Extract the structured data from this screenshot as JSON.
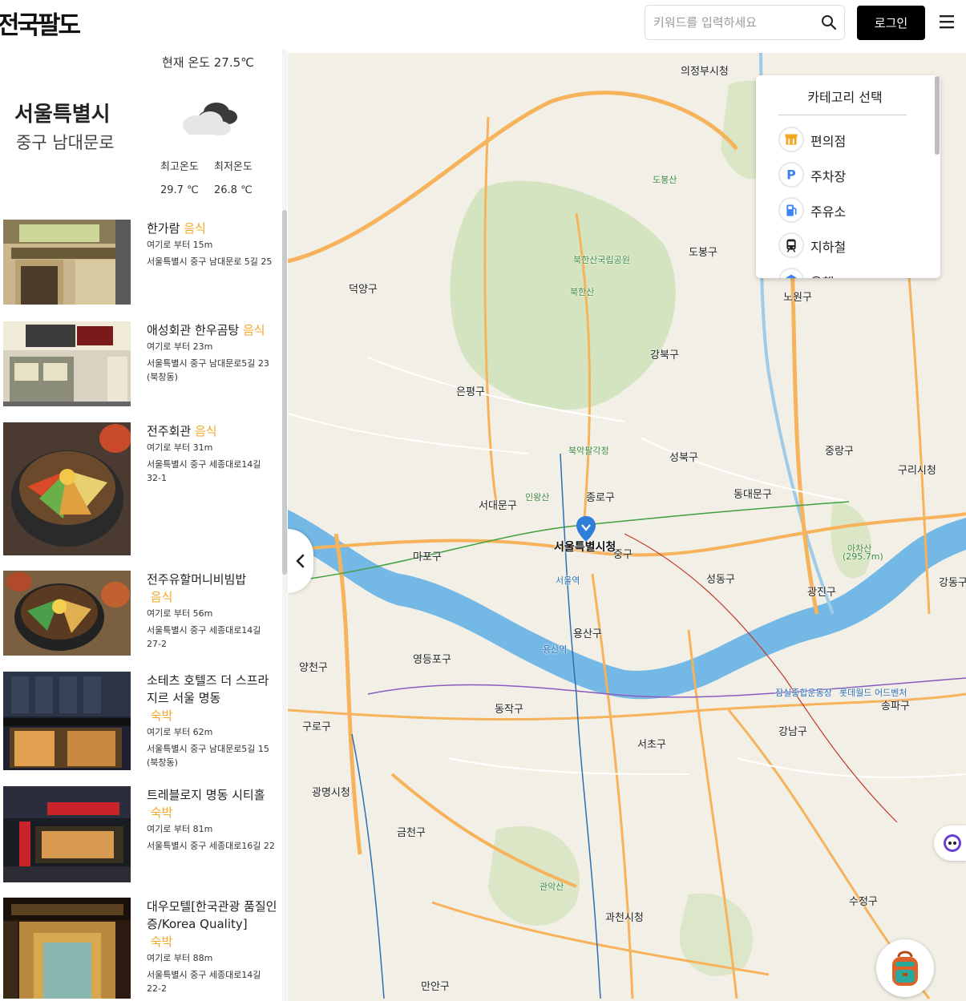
{
  "header": {
    "logo": "전국팔도",
    "search_placeholder": "키워드를 입력하세요",
    "login_label": "로그인"
  },
  "weather": {
    "current_temp": "현재 온도 27.5℃",
    "city": "서울특별시",
    "district": "중구 남대문로",
    "high_label": "최고온도",
    "low_label": "최저온도",
    "high_value": "29.7 ℃",
    "low_value": "26.8 ℃",
    "icon": "cloudy-icon"
  },
  "places": [
    {
      "name": "한가람",
      "category": "음식",
      "distance": "여기로 부터 15m",
      "address": "서울특별시 중구 남대문로 5길 25"
    },
    {
      "name": "애성회관 한우곰탕",
      "category": "음식",
      "distance": "여기로 부터 23m",
      "address": "서울특별시 중구 남대문로5길 23 (북창동)"
    },
    {
      "name": "전주회관",
      "category": "음식",
      "distance": "여기로 부터 31m",
      "address": "서울특별시 중구 세종대로14길 32-1"
    },
    {
      "name": "전주유할머니비빔밥",
      "category": "음식",
      "distance": "여기로 부터 56m",
      "address": "서울특별시 중구 세종대로14길 27-2"
    },
    {
      "name": "소테츠 호텔즈 더 스프라지르 서울 명동",
      "category": "숙박",
      "distance": "여기로 부터 62m",
      "address": "서울특별시 중구 남대문로5길 15 (북창동)"
    },
    {
      "name": "트레블로지 명동 시티홀",
      "category": "숙박",
      "distance": "여기로 부터 81m",
      "address": "서울특별시 중구 세종대로16길 22"
    },
    {
      "name": "대우모텔[한국관광 품질인증/Korea Quality]",
      "category": "숙박",
      "distance": "여기로 부터 88m",
      "address": "서울특별시 중구 세종대로14길 22-2"
    }
  ],
  "map": {
    "center_label": "서울특별시청",
    "labels": {
      "uijeongbu": "의정부시청",
      "dobongsan": "도봉산",
      "bukhansan": "북한산",
      "bukhansan_park": "북한산국립공원",
      "dobong": "도봉구",
      "nowon": "노원구",
      "gangbuk": "강북구",
      "deokyang": "덕양구",
      "eunpyeong": "은평구",
      "seongbuk": "성북구",
      "jungnang": "중랑구",
      "guri": "구리시청",
      "seodaemun": "서대문구",
      "jongno": "종로구",
      "dongdaemun": "동대문구",
      "mapo": "마포구",
      "jung": "중구",
      "seongdong": "성동구",
      "gwangjin": "광진구",
      "yongsan": "용산구",
      "yangcheon": "양천구",
      "yeongdeungpo": "영등포구",
      "dongjak": "동작구",
      "gangnam": "강남구",
      "songpa": "송파구",
      "guro": "구로구",
      "seocho": "서초구",
      "gwangmyeong": "광명시청",
      "geumcheon": "금천구",
      "gwanak": "관악산",
      "gwacheon": "과천시청",
      "sujeong": "수정구",
      "manan": "만안구",
      "achasan": "아차산",
      "achasan_h": "(295.7m)",
      "bugak": "북악팔각정",
      "inwang": "인왕산",
      "gangdong": "강동구",
      "lotte": "롯데월드 어드벤처",
      "jamsil": "잠실종합운동장",
      "seoul_stn": "서울역",
      "yongsan_stn": "용산역"
    }
  },
  "categories": {
    "title": "카테고리 선택",
    "items": [
      {
        "label": "편의점",
        "icon": "convenience-store-icon",
        "color": "#f5a623"
      },
      {
        "label": "주차장",
        "icon": "parking-icon",
        "color": "#3b82f6"
      },
      {
        "label": "주유소",
        "icon": "gas-station-icon",
        "color": "#3b82f6"
      },
      {
        "label": "지하철",
        "icon": "subway-icon",
        "color": "#222222"
      },
      {
        "label": "은행",
        "icon": "bank-icon",
        "color": "#3b82f6"
      }
    ]
  },
  "colors": {
    "accent": "#f5a623",
    "river": "#74b8e6",
    "park": "#c9dfb0",
    "road_major": "#f6b35c",
    "road_minor": "#ffffff"
  }
}
